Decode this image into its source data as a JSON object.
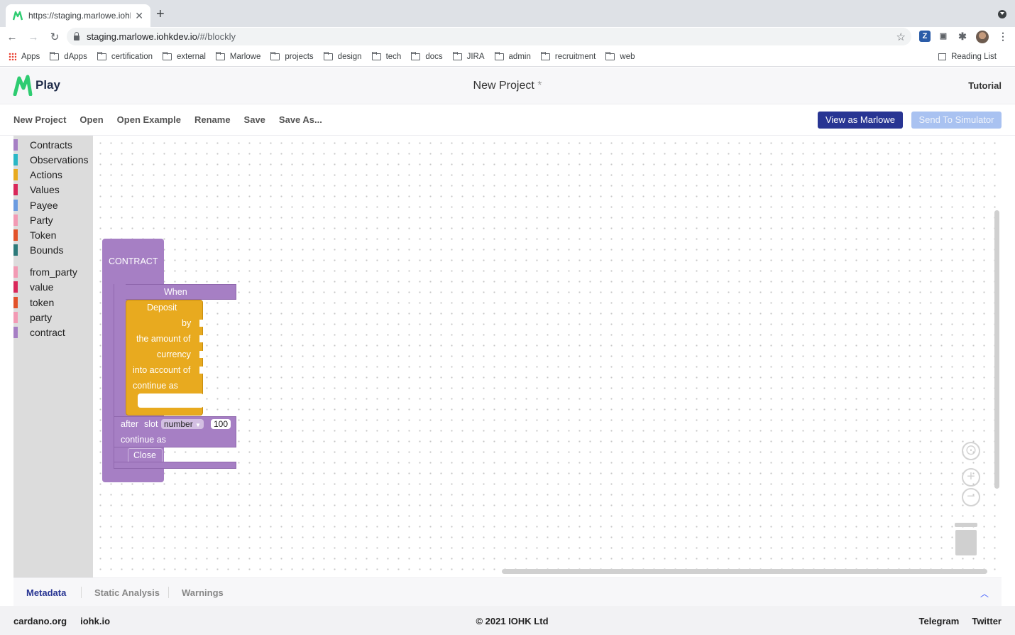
{
  "browser": {
    "tab_title": "https://staging.marlowe.iohkdev.io",
    "new_tab_label": "+",
    "close_tab_label": "✕",
    "url_host": "staging.marlowe.iohkdev.io",
    "url_path": "/#/blockly",
    "extensions": [
      {
        "name": "zotero",
        "label": "Z",
        "color": "#2b5ca8"
      },
      {
        "name": "tab-manager",
        "label": "▣",
        "color": "#5f6368"
      },
      {
        "name": "extensions",
        "label": "✱",
        "color": "#5f6368"
      }
    ],
    "bookmarks": [
      "Apps",
      "dApps",
      "certification",
      "external",
      "Marlowe",
      "projects",
      "design",
      "tech",
      "docs",
      "JIRA",
      "admin",
      "recruitment",
      "web"
    ],
    "reading_list": "Reading List"
  },
  "header": {
    "logo_text": "Play",
    "project_title": "New Project",
    "dirty_marker": "*",
    "tutorial": "Tutorial"
  },
  "menu": {
    "items": [
      "New Project",
      "Open",
      "Open Example",
      "Rename",
      "Save",
      "Save As..."
    ],
    "view_as_marlowe": "View as Marlowe",
    "send_to_simulator": "Send To Simulator"
  },
  "toolbox": {
    "categories": [
      {
        "label": "Contracts",
        "color": "#a67fc4"
      },
      {
        "label": "Observations",
        "color": "#2ab7c6"
      },
      {
        "label": "Actions",
        "color": "#e8aa1f"
      },
      {
        "label": "Values",
        "color": "#d9285a"
      },
      {
        "label": "Payee",
        "color": "#6b9be0"
      },
      {
        "label": "Party",
        "color": "#f29ab4"
      },
      {
        "label": "Token",
        "color": "#e2522a"
      },
      {
        "label": "Bounds",
        "color": "#2d7a7a"
      }
    ],
    "holes": [
      {
        "label": "from_party",
        "color": "#f29ab4"
      },
      {
        "label": "value",
        "color": "#d9285a"
      },
      {
        "label": "token",
        "color": "#e2522a"
      },
      {
        "label": "party",
        "color": "#f29ab4"
      },
      {
        "label": "contract",
        "color": "#a67fc4"
      }
    ]
  },
  "blocks": {
    "contract_label": "CONTRACT",
    "when_label": "When",
    "deposit": {
      "title": "Deposit",
      "by": "by",
      "amount": "the amount of",
      "currency": "currency",
      "into_account": "into account of",
      "continue_as": "continue as"
    },
    "after": "after",
    "slot": "slot",
    "slot_type": "number",
    "timeout_value": "100",
    "continue_as": "continue as",
    "close": "Close"
  },
  "bottom_tabs": [
    "Metadata",
    "Static Analysis",
    "Warnings"
  ],
  "footer": {
    "links_left": [
      "cardano.org",
      "iohk.io"
    ],
    "copyright": "© 2021 IOHK Ltd",
    "links_right": [
      "Telegram",
      "Twitter"
    ]
  }
}
